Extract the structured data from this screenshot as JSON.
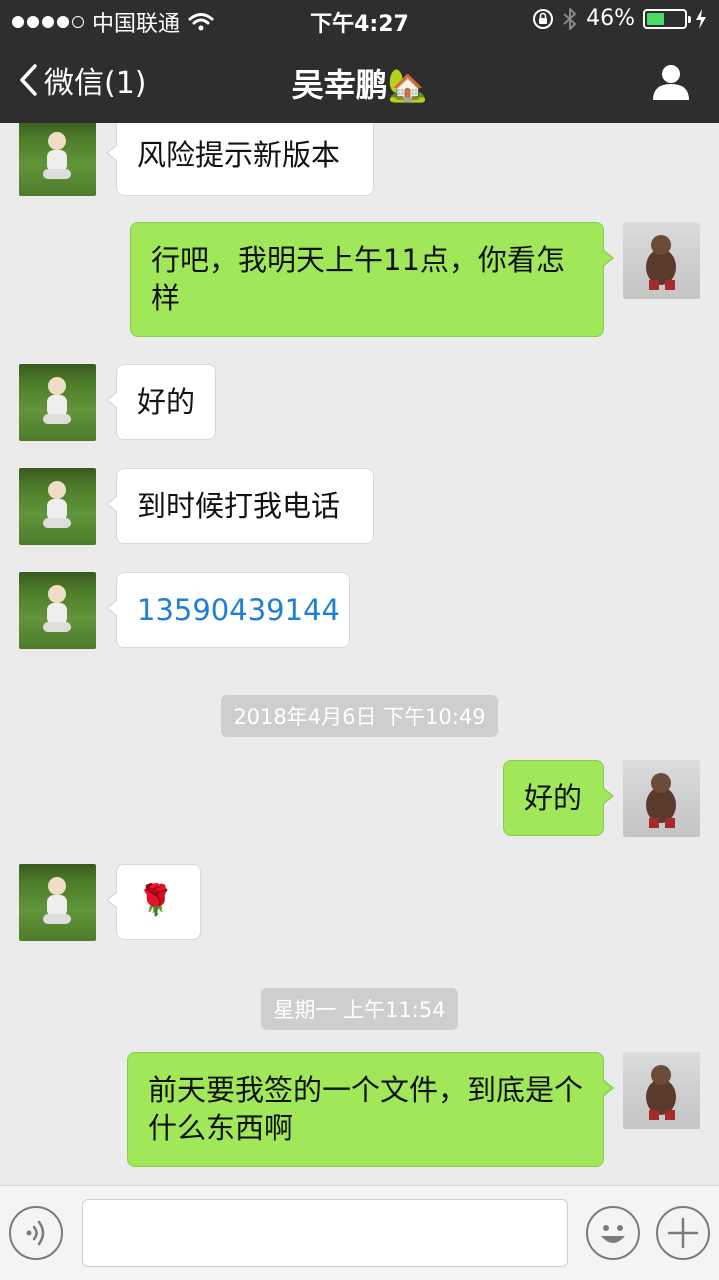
{
  "status_bar": {
    "carrier": "中国联通",
    "time": "下午4:27",
    "battery_percent": "46%",
    "battery_level": 0.46,
    "signal_icon": "signal-dots-icon",
    "wifi_icon": "wifi-icon",
    "lock_icon": "rotation-lock-icon",
    "bluetooth_icon": "bluetooth-icon",
    "charging_icon": "charging-bolt-icon"
  },
  "nav": {
    "back_label": "微信(1)",
    "title": "吴幸鹏",
    "title_emoji": "🏡",
    "profile_icon": "person-icon"
  },
  "messages": [
    {
      "side": "left",
      "text": "风险提示新版本"
    },
    {
      "side": "right",
      "text": "行吧，我明天上午11点，你看怎样"
    },
    {
      "side": "left",
      "text": "好的"
    },
    {
      "side": "left",
      "text": "到时候打我电话"
    },
    {
      "side": "left",
      "text": "13590439144",
      "is_link": true
    },
    {
      "side": "right",
      "text": "好的"
    },
    {
      "side": "left",
      "text": "🌹",
      "is_emoji": true
    },
    {
      "side": "right",
      "text": "前天要我签的一个文件，到底是个什么东西啊"
    }
  ],
  "timestamps": [
    "2018年4月6日 下午10:49",
    "星期一 上午11:54"
  ],
  "input_bar": {
    "voice_icon": "voice-icon",
    "text_value": "",
    "emoji_icon": "emoji-icon",
    "plus_icon": "plus-icon"
  },
  "colors": {
    "bar_bg": "#2e2e2e",
    "chat_bg": "#ebebeb",
    "bubble_sent": "#a0e75a",
    "bubble_received": "#ffffff",
    "link": "#1e7fd8",
    "battery_fill": "#4cd964"
  }
}
